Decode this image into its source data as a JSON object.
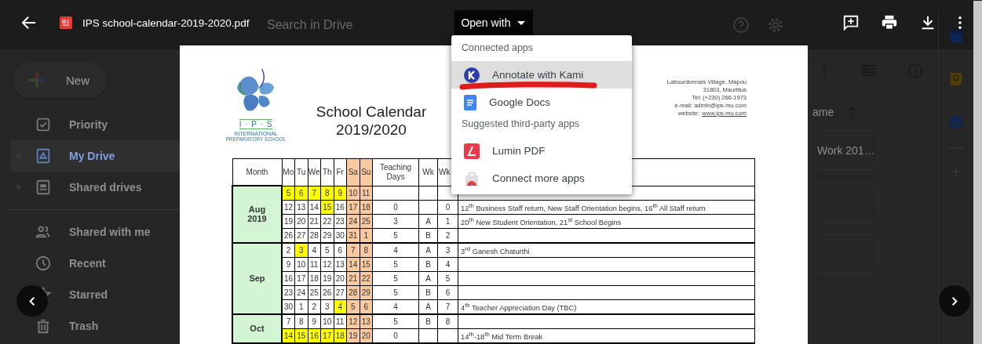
{
  "drive": {
    "search": {
      "placeholder": "Search in Drive"
    },
    "new_button": "New",
    "nav": [
      {
        "label": "Priority",
        "kind": "priority",
        "selected": false,
        "expandable": false,
        "divider_before": false
      },
      {
        "label": "My Drive",
        "kind": "drive",
        "selected": true,
        "expandable": true,
        "divider_before": false
      },
      {
        "label": "Shared drives",
        "kind": "shared-drives",
        "selected": false,
        "expandable": true,
        "divider_before": false
      },
      {
        "label": "Shared with me",
        "kind": "people",
        "selected": false,
        "expandable": false,
        "divider_before": true
      },
      {
        "label": "Recent",
        "kind": "clock",
        "selected": false,
        "expandable": false,
        "divider_before": false
      },
      {
        "label": "Starred",
        "kind": "star",
        "selected": false,
        "expandable": false,
        "divider_before": false
      },
      {
        "label": "Trash",
        "kind": "trash",
        "selected": false,
        "expandable": false,
        "divider_before": false
      }
    ],
    "sort_label": "ame",
    "files": [
      {
        "kind": "file",
        "name": "Work 201…"
      },
      {
        "kind": "blank"
      },
      {
        "kind": "blank"
      }
    ]
  },
  "viewer": {
    "file_name": "IPS school-calendar-2019-2020.pdf",
    "open_with": "Open with",
    "menu": [
      {
        "heading": "Connected apps",
        "items": [
          {
            "label": "Annotate with Kami",
            "kind": "kami",
            "selected": true,
            "scribbled": true
          },
          {
            "label": "Google Docs",
            "kind": "docs",
            "selected": false,
            "scribbled": false
          }
        ]
      },
      {
        "heading": "Suggested third-party apps",
        "items": [
          {
            "label": "Lumin PDF",
            "kind": "lumin",
            "selected": false,
            "scribbled": false
          },
          {
            "label": "Connect more apps",
            "kind": "store",
            "selected": false,
            "scribbled": false
          }
        ]
      }
    ]
  },
  "document": {
    "logo_letters": "I · P · S",
    "logo_name": "INTERNATIONAL",
    "logo_sub": "PREPARATORY SCHOOL",
    "title": "School Calendar",
    "year": "2019/2020",
    "address": [
      "Labourdonnais Village, Mapou",
      "31803, Mauritius",
      "Tel: (+230) 266-1973",
      "e-mail: admin@ips-mu.com"
    ],
    "website_label": "website:",
    "website": "www.ips-mu.com",
    "header": {
      "month": "Month",
      "days": [
        {
          "label": "Mo",
          "weekend": false
        },
        {
          "label": "Tu",
          "weekend": false
        },
        {
          "label": "We",
          "weekend": false
        },
        {
          "label": "Th",
          "weekend": false
        },
        {
          "label": "Fr",
          "weekend": false
        },
        {
          "label": "Sa",
          "weekend": true
        },
        {
          "label": "Su",
          "weekend": true
        }
      ],
      "teaching": "Teaching Days",
      "wk_a": "Wk",
      "wk_b": "Wk"
    },
    "months": [
      {
        "label": [
          "Aug",
          "2019"
        ],
        "rows": [
          {
            "days": [
              {
                "d": "5",
                "highlight": true
              },
              {
                "d": "6",
                "highlight": true
              },
              {
                "d": "7",
                "highlight": true
              },
              {
                "d": "8",
                "highlight": true
              },
              {
                "d": "9",
                "highlight": true
              },
              {
                "d": "10",
                "highlight": false
              },
              {
                "d": "11",
                "highlight": false
              }
            ],
            "teaching": "",
            "wk_a": "",
            "wk_b": "",
            "event": ""
          },
          {
            "days": [
              {
                "d": "12",
                "highlight": false
              },
              {
                "d": "13",
                "highlight": false
              },
              {
                "d": "14",
                "highlight": false
              },
              {
                "d": "15",
                "highlight": true
              },
              {
                "d": "16",
                "highlight": false
              },
              {
                "d": "17",
                "highlight": false
              },
              {
                "d": "18",
                "highlight": false
              }
            ],
            "teaching": "0",
            "wk_a": "",
            "wk_b": "0",
            "event": "12$^{th}$ Business Staff return, New Staff Orientation begins, 16$^{th}$ All Staff return"
          },
          {
            "days": [
              {
                "d": "19",
                "highlight": false
              },
              {
                "d": "20",
                "highlight": false
              },
              {
                "d": "21",
                "highlight": false
              },
              {
                "d": "22",
                "highlight": false
              },
              {
                "d": "23",
                "highlight": false
              },
              {
                "d": "24",
                "highlight": false
              },
              {
                "d": "25",
                "highlight": false
              }
            ],
            "teaching": "3",
            "wk_a": "A",
            "wk_b": "1",
            "event": "20$^{th}$ New Student Orientation, 21$^{st}$ School Begins"
          },
          {
            "days": [
              {
                "d": "26",
                "highlight": false
              },
              {
                "d": "27",
                "highlight": false
              },
              {
                "d": "28",
                "highlight": false
              },
              {
                "d": "29",
                "highlight": false
              },
              {
                "d": "30",
                "highlight": false
              },
              {
                "d": "31",
                "highlight": false
              },
              {
                "d": "1",
                "highlight": false
              }
            ],
            "teaching": "5",
            "wk_a": "B",
            "wk_b": "2",
            "event": ""
          }
        ]
      },
      {
        "label": [
          "Sep"
        ],
        "rows": [
          {
            "days": [
              {
                "d": "2",
                "highlight": false
              },
              {
                "d": "3",
                "highlight": true
              },
              {
                "d": "4",
                "highlight": false
              },
              {
                "d": "5",
                "highlight": false
              },
              {
                "d": "6",
                "highlight": false
              },
              {
                "d": "7",
                "highlight": false
              },
              {
                "d": "8",
                "highlight": false
              }
            ],
            "teaching": "4",
            "wk_a": "A",
            "wk_b": "3",
            "event": "3$^{rd}$ Ganesh Chaturthi"
          },
          {
            "days": [
              {
                "d": "9",
                "highlight": false
              },
              {
                "d": "10",
                "highlight": false
              },
              {
                "d": "11",
                "highlight": false
              },
              {
                "d": "12",
                "highlight": false
              },
              {
                "d": "13",
                "highlight": false
              },
              {
                "d": "14",
                "highlight": false
              },
              {
                "d": "15",
                "highlight": false
              }
            ],
            "teaching": "5",
            "wk_a": "B",
            "wk_b": "4",
            "event": ""
          },
          {
            "days": [
              {
                "d": "16",
                "highlight": false
              },
              {
                "d": "17",
                "highlight": false
              },
              {
                "d": "18",
                "highlight": false
              },
              {
                "d": "19",
                "highlight": false
              },
              {
                "d": "20",
                "highlight": false
              },
              {
                "d": "21",
                "highlight": false
              },
              {
                "d": "22",
                "highlight": false
              }
            ],
            "teaching": "5",
            "wk_a": "A",
            "wk_b": "5",
            "event": ""
          },
          {
            "days": [
              {
                "d": "23",
                "highlight": false
              },
              {
                "d": "24",
                "highlight": false
              },
              {
                "d": "25",
                "highlight": false
              },
              {
                "d": "26",
                "highlight": false
              },
              {
                "d": "27",
                "highlight": false
              },
              {
                "d": "28",
                "highlight": false
              },
              {
                "d": "29",
                "highlight": false
              }
            ],
            "teaching": "5",
            "wk_a": "B",
            "wk_b": "6",
            "event": ""
          },
          {
            "days": [
              {
                "d": "30",
                "highlight": false
              },
              {
                "d": "1",
                "highlight": false
              },
              {
                "d": "2",
                "highlight": false
              },
              {
                "d": "3",
                "highlight": false
              },
              {
                "d": "4",
                "highlight": true
              },
              {
                "d": "5",
                "highlight": false
              },
              {
                "d": "6",
                "highlight": false
              }
            ],
            "teaching": "4",
            "wk_a": "A",
            "wk_b": "7",
            "event": "4$^{th}$ Teacher Appreciation Day (TBC)"
          }
        ]
      },
      {
        "label": [
          "Oct"
        ],
        "rows": [
          {
            "days": [
              {
                "d": "7",
                "highlight": false
              },
              {
                "d": "8",
                "highlight": false
              },
              {
                "d": "9",
                "highlight": false
              },
              {
                "d": "10",
                "highlight": false
              },
              {
                "d": "11",
                "highlight": false
              },
              {
                "d": "12",
                "highlight": false
              },
              {
                "d": "13",
                "highlight": false
              }
            ],
            "teaching": "5",
            "wk_a": "B",
            "wk_b": "8",
            "event": ""
          },
          {
            "days": [
              {
                "d": "14",
                "highlight": true
              },
              {
                "d": "15",
                "highlight": true
              },
              {
                "d": "16",
                "highlight": true
              },
              {
                "d": "17",
                "highlight": true
              },
              {
                "d": "18",
                "highlight": true
              },
              {
                "d": "19",
                "highlight": false
              },
              {
                "d": "20",
                "highlight": false
              }
            ],
            "teaching": "0",
            "wk_a": "",
            "wk_b": "",
            "event": "14$^{th}$-18$^{th}$ Mid Term Break"
          }
        ]
      }
    ]
  }
}
